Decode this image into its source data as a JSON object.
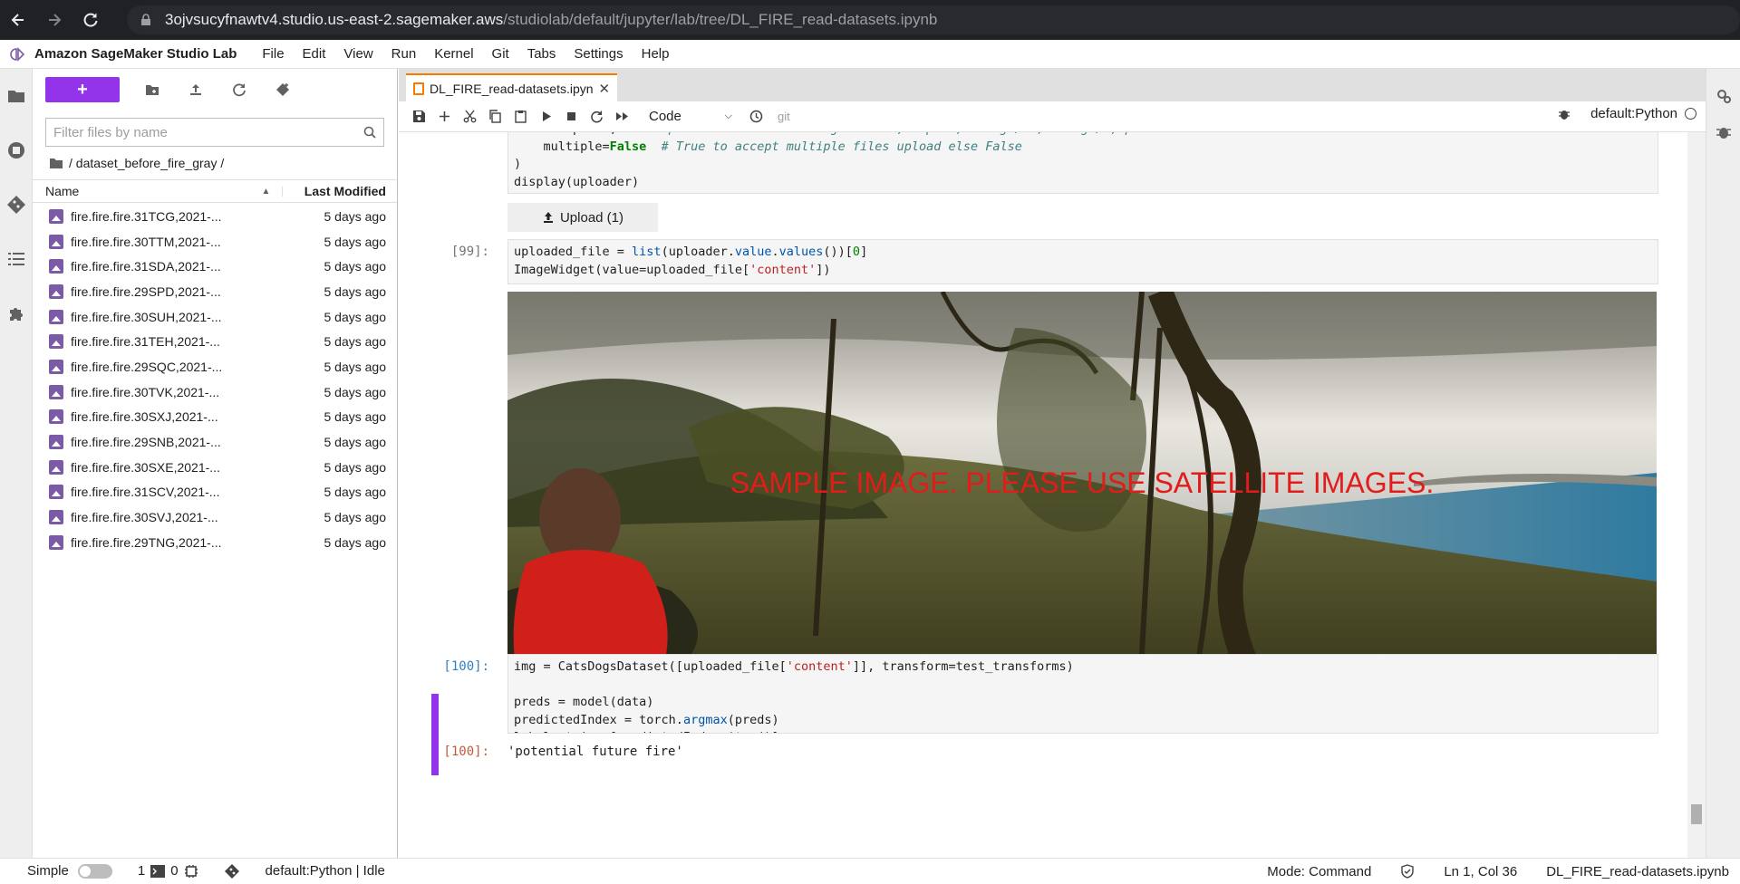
{
  "browser": {
    "url_host": "3ojvsucyfnawtv4.studio.us-east-2.sagemaker.aws",
    "url_path": "/studiolab/default/jupyter/lab/tree/DL_FIRE_read-datasets.ipynb"
  },
  "app": {
    "title": "Amazon SageMaker Studio Lab",
    "menu": [
      "File",
      "Edit",
      "View",
      "Run",
      "Kernel",
      "Git",
      "Tabs",
      "Settings",
      "Help"
    ]
  },
  "filebrowser": {
    "new_label": "+",
    "search_placeholder": "Filter files by name",
    "breadcrumb": "/ dataset_before_fire_gray /",
    "col_name": "Name",
    "col_modified": "Last Modified",
    "files": [
      {
        "name": "fire.fire.fire.31TCG,2021-...",
        "modified": "5 days ago"
      },
      {
        "name": "fire.fire.fire.30TTM,2021-...",
        "modified": "5 days ago"
      },
      {
        "name": "fire.fire.fire.31SDA,2021-...",
        "modified": "5 days ago"
      },
      {
        "name": "fire.fire.fire.29SPD,2021-...",
        "modified": "5 days ago"
      },
      {
        "name": "fire.fire.fire.30SUH,2021-...",
        "modified": "5 days ago"
      },
      {
        "name": "fire.fire.fire.31TEH,2021-...",
        "modified": "5 days ago"
      },
      {
        "name": "fire.fire.fire.29SQC,2021-...",
        "modified": "5 days ago"
      },
      {
        "name": "fire.fire.fire.30TVK,2021-...",
        "modified": "5 days ago"
      },
      {
        "name": "fire.fire.fire.30SXJ,2021-...",
        "modified": "5 days ago"
      },
      {
        "name": "fire.fire.fire.29SNB,2021-...",
        "modified": "5 days ago"
      },
      {
        "name": "fire.fire.fire.30SXE,2021-...",
        "modified": "5 days ago"
      },
      {
        "name": "fire.fire.fire.31SCV,2021-...",
        "modified": "5 days ago"
      },
      {
        "name": "fire.fire.fire.30SVJ,2021-...",
        "modified": "5 days ago"
      },
      {
        "name": "fire.fire.fire.29TNG,2021-...",
        "modified": "5 days ago"
      }
    ]
  },
  "notebook": {
    "tab_title": "DL_FIRE_read-datasets.ipyn",
    "cell_type": "Code",
    "git_label": "git",
    "kernel": "default:Python",
    "upload_label": "Upload (1)",
    "prompt_99": "[99]:",
    "prompt_100_in": "[100]:",
    "prompt_100_out": "[100]:",
    "output_text": "'potential future fire'",
    "image_overlay": "SAMPLE IMAGE. PLEASE USE SATELLITE IMAGES."
  },
  "statusbar": {
    "mode_simple": "Simple",
    "terminals": "1",
    "kernels": "0",
    "kernel_status": "default:Python | Idle",
    "mode": "Mode: Command",
    "position": "Ln 1, Col 36",
    "filename": "DL_FIRE_read-datasets.ipynb"
  },
  "colors": {
    "accent": "#9333ea",
    "tab_accent": "#f57c00"
  }
}
